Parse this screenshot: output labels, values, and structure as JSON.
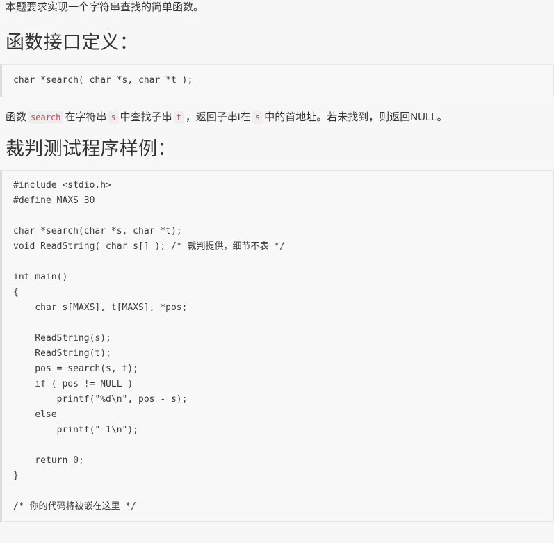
{
  "intro": {
    "text": "本题要求实现一个字符串查找的简单函数。"
  },
  "sections": [
    {
      "heading": "函数接口定义：",
      "code": "char *search( char *s, char *t );"
    },
    {
      "heading": "裁判测试程序样例：",
      "code": "#include <stdio.h>\n#define MAXS 30\n\nchar *search(char *s, char *t);\nvoid ReadString( char s[] ); /* 裁判提供，细节不表 */\n\nint main()\n{\n    char s[MAXS], t[MAXS], *pos;\n\n    ReadString(s);\n    ReadString(t);\n    pos = search(s, t);\n    if ( pos != NULL )\n        printf(\"%d\\n\", pos - s);\n    else\n        printf(\"-1\\n\");\n\n    return 0;\n}\n\n/* 你的代码将被嵌在这里 */"
    }
  ],
  "description": {
    "part1": "函数",
    "code1": "search",
    "part2": "在字符串",
    "code2": "s",
    "part3": "中查找子串",
    "code3": "t",
    "part4": "，返回子串t在",
    "code4": "s",
    "part5": "中的首地址。若未找到，则返回NULL。"
  },
  "colors": {
    "page_background": "#f7f7f7",
    "code_background": "#f8f8f8",
    "code_border": "#e6e6e6",
    "code_border_left": "#dcdcdc",
    "text": "#333333",
    "code_text": "#3b3b40",
    "inline_code_text": "#c0504d",
    "inline_code_background": "#f0eef0"
  }
}
